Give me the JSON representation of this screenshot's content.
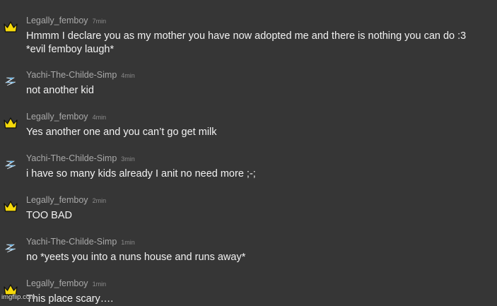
{
  "messages": [
    {
      "author": "Legally_femboy",
      "time": "7min",
      "avatar": "crown-icon",
      "text": "Hmmm I declare you as my mother you have now adopted me and there is nothing you can do :3\n*evil femboy laugh*"
    },
    {
      "author": "Yachi-The-Childe-Simp",
      "time": "4min",
      "avatar": "lightning-icon",
      "text": "not another kid"
    },
    {
      "author": "Legally_femboy",
      "time": "4min",
      "avatar": "crown-icon",
      "text": "Yes another one and you can’t go get milk"
    },
    {
      "author": "Yachi-The-Childe-Simp",
      "time": "3min",
      "avatar": "lightning-icon",
      "text": "i have so many kids already I anit no need more ;-;"
    },
    {
      "author": "Legally_femboy",
      "time": "2min",
      "avatar": "crown-icon",
      "text": "TOO BAD"
    },
    {
      "author": "Yachi-The-Childe-Simp",
      "time": "1min",
      "avatar": "lightning-icon",
      "text": "no *yeets you into a nuns house and runs away*"
    },
    {
      "author": "Legally_femboy",
      "time": "1min",
      "avatar": "crown-icon",
      "text": "This place scary…."
    }
  ],
  "watermark": "imgflip.com",
  "colors": {
    "background": "#363636",
    "text": "#f2f2f2",
    "username": "#a9a9a9",
    "crown": "#f5d90a",
    "lightning": "#2f9be0"
  }
}
